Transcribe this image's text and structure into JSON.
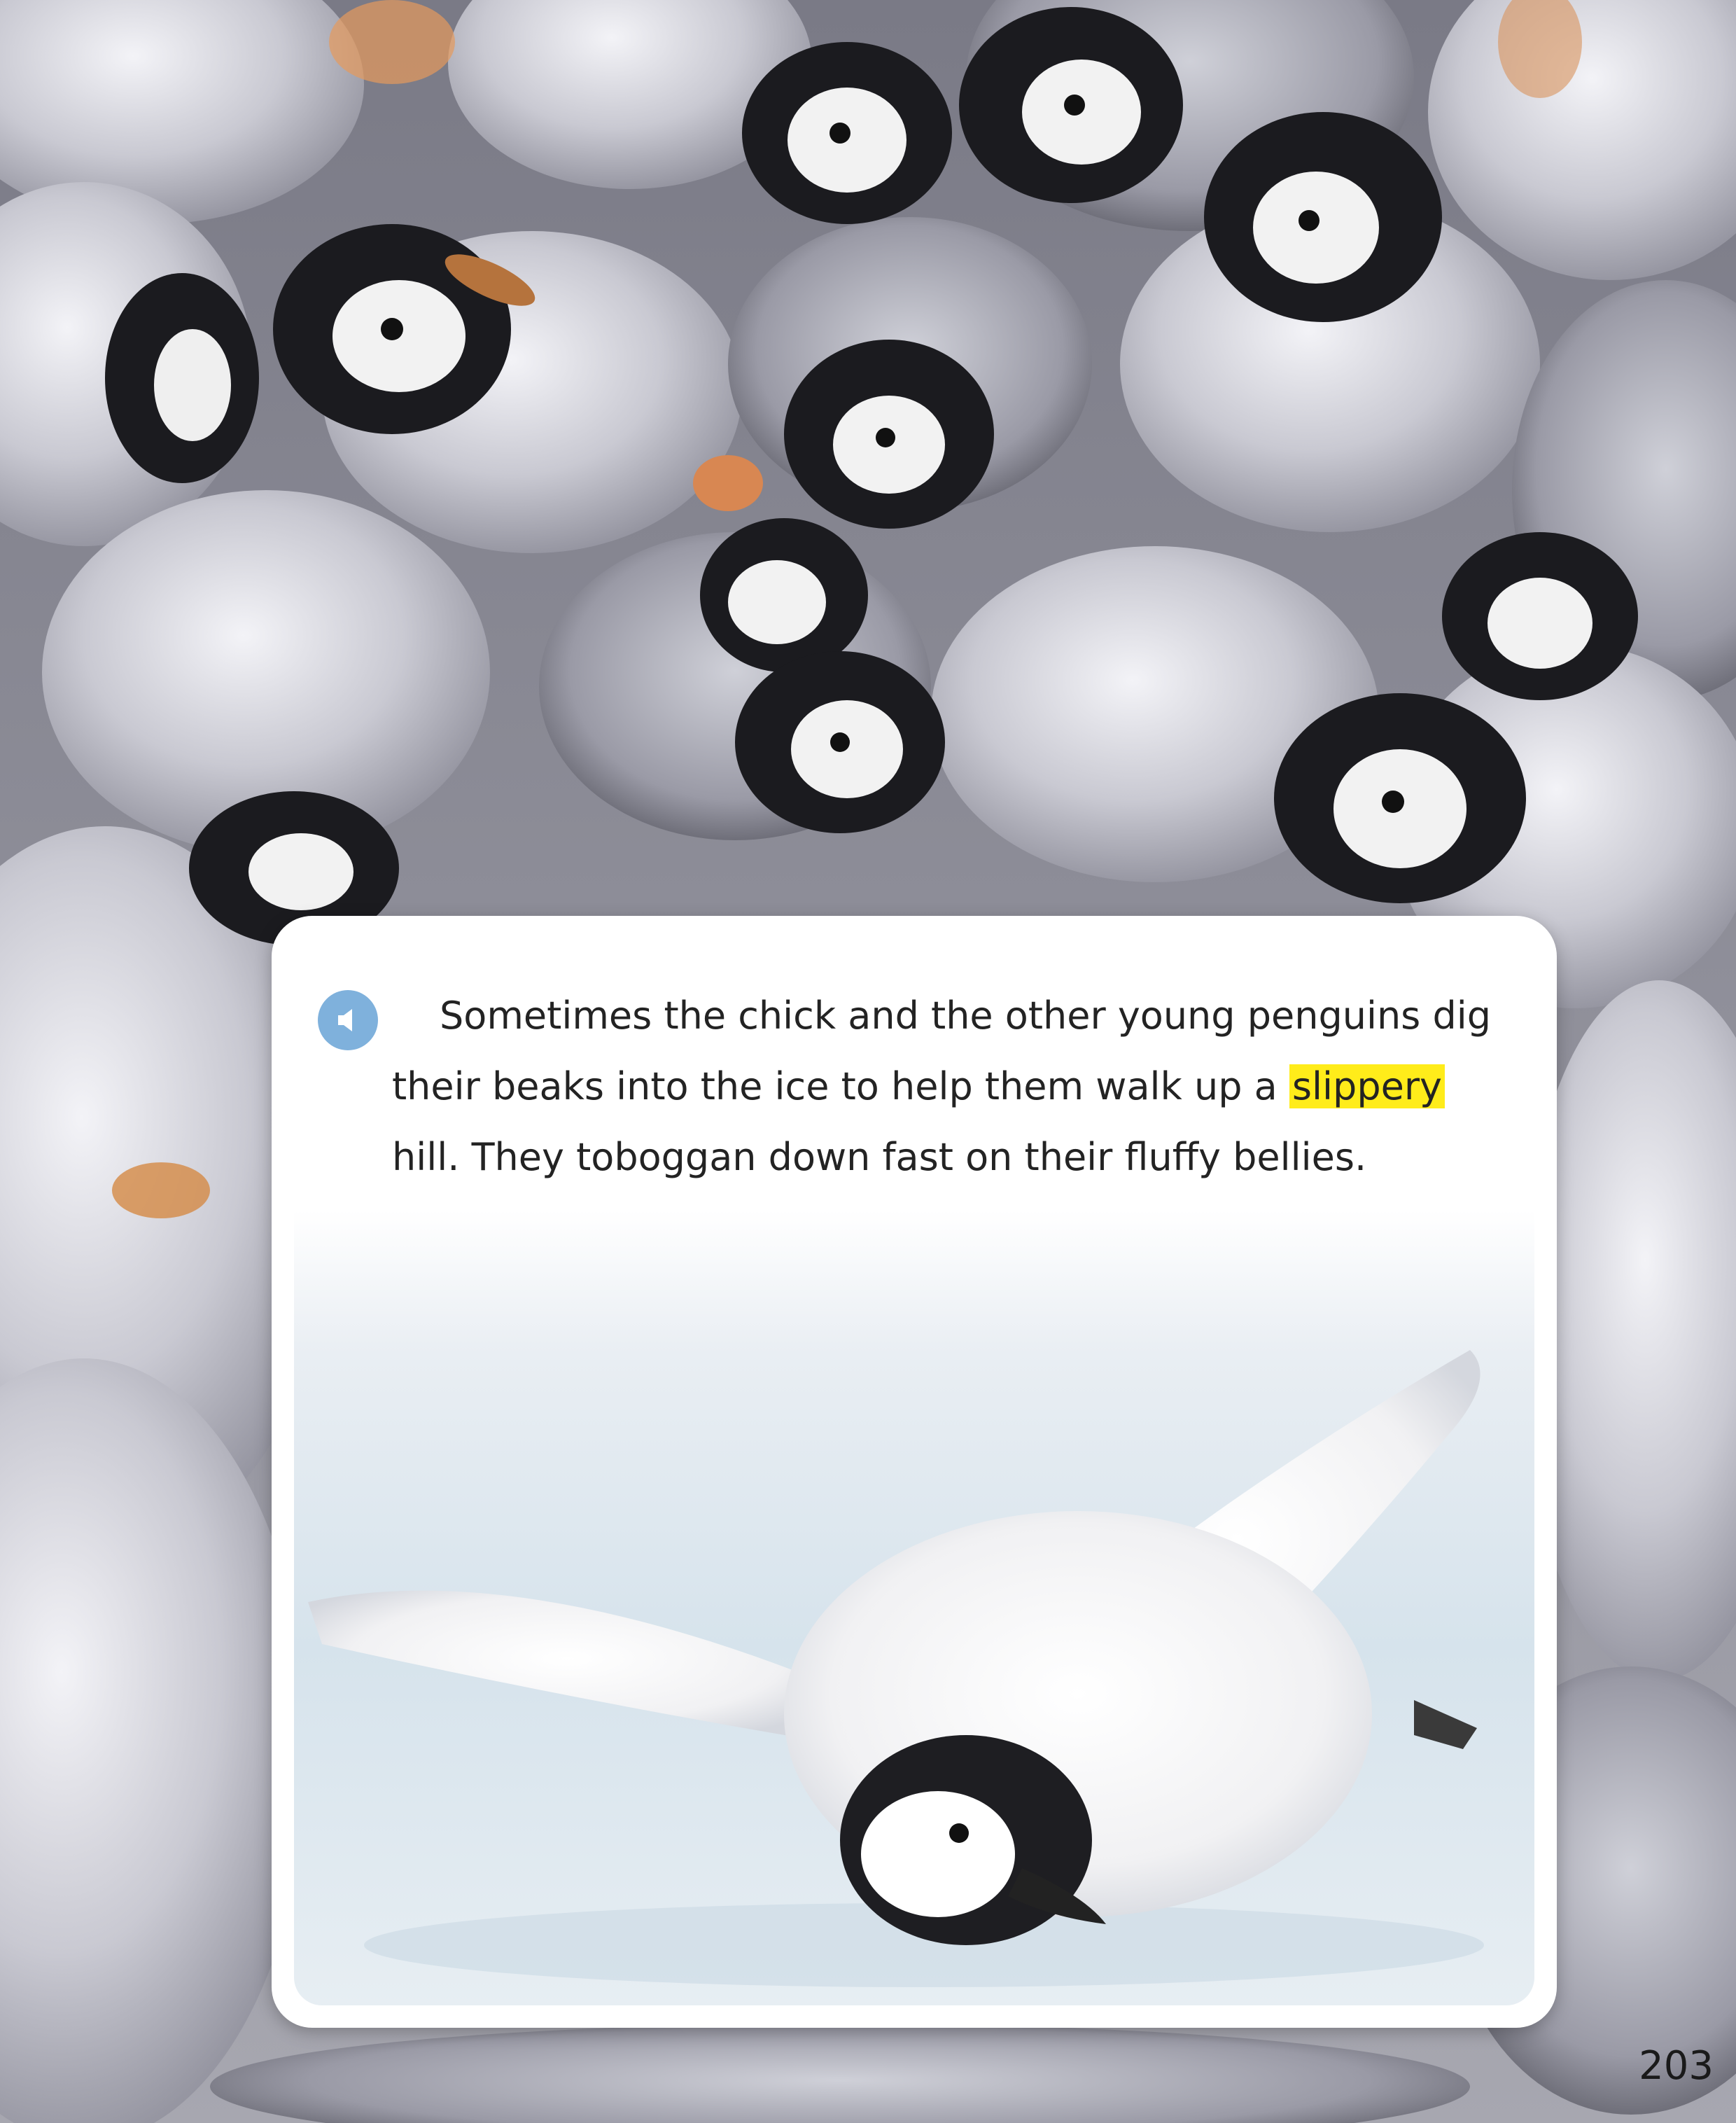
{
  "reading": {
    "audio_icon": "speaker-icon",
    "text_before": "Sometimes the chick and the other young penguins dig their beaks into the ice to help them walk up a ",
    "highlight_word": "slippery",
    "text_after": " hill.  They toboggan down fast on their fluffy bellies."
  },
  "page_number": "203",
  "colors": {
    "highlight": "#ffec1a",
    "audio_button": "#7fb1dc"
  }
}
